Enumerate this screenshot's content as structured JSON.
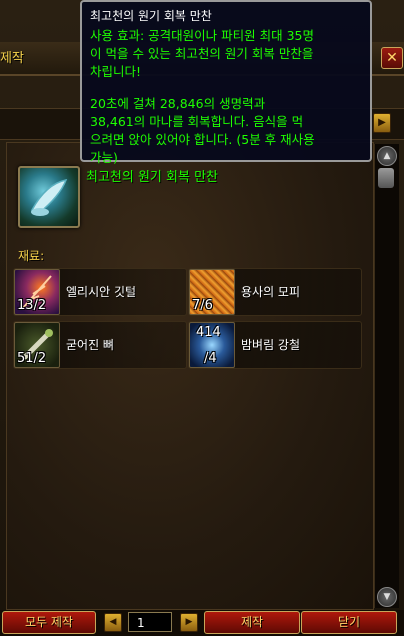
{
  "window": {
    "title_partial": "제작",
    "close_label": "✕"
  },
  "tooltip": {
    "title": "최고천의 원기 회복 만찬",
    "use_lines": [
      "사용 효과: 공격대원이나 파티원 최대 35명",
      "이 먹을 수 있는 최고천의 원기 회복 만찬을",
      "차립니다!"
    ],
    "effect_lines": [
      "20초에 걸쳐 28,846의 생명력과",
      "38,461의 마나를 회복합니다. 음식을 먹",
      "으려면 앉아 있어야 합니다. (5분 후 재사용",
      "가능)"
    ]
  },
  "recipe": {
    "name": "최고천의 원기 회복 만찬",
    "icon": "feast-icon",
    "reagents_label": "재료:",
    "reagents": [
      {
        "name": "엘리시안 깃털",
        "count": "13/2",
        "icon": "feather-icon"
      },
      {
        "name": "용사의 모피",
        "count": "7/6",
        "icon": "fur-icon"
      },
      {
        "name": "굳어진 뼈",
        "count": "51/2",
        "icon": "bone-icon"
      },
      {
        "name": "밤벼림 강철",
        "count_top": "414",
        "count_bottom": "/4",
        "icon": "steel-icon"
      }
    ]
  },
  "bottom": {
    "create_all": "모두 제작",
    "quantity": "1",
    "create": "제작",
    "close": "닫기"
  },
  "scroll": {
    "up": "▲",
    "down": "▼"
  }
}
